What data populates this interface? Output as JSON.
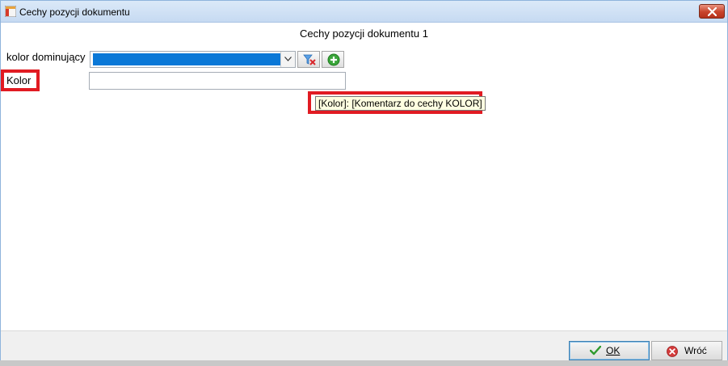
{
  "window": {
    "title": "Cechy pozycji dokumentu",
    "icon": "app-window-icon",
    "close_icon": "close-icon"
  },
  "form": {
    "heading": "Cechy pozycji dokumentu 1",
    "fields": [
      {
        "label": "kolor dominujący",
        "type": "combo",
        "selected_value": "",
        "highlight_color": "#0a78d7",
        "buttons": [
          {
            "icon": "filter-clear-icon"
          },
          {
            "icon": "add-green-icon"
          }
        ]
      },
      {
        "label": "Kolor",
        "type": "text",
        "value": ""
      }
    ],
    "tooltip": "[Kolor]: [Komentarz do cechy KOLOR]"
  },
  "footer": {
    "ok_label": "OK",
    "back_label": "Wróć"
  },
  "colors": {
    "annotation_red": "#e11b22",
    "tooltip_bg": "#ffffe1",
    "close_red": "#c8432b"
  }
}
